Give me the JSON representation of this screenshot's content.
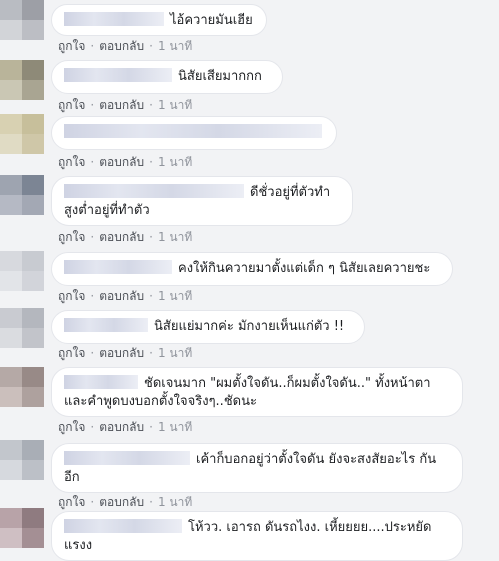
{
  "actions": {
    "like": "ถูกใจ",
    "reply": "ตอบกลับ",
    "separator": "·",
    "time": "1 นาที"
  },
  "comments": [
    {
      "text": "ไอ้ควายมันเฮีย",
      "avatar": [
        "#b9bcc2",
        "#9d9fa6",
        "#d2d4d8",
        "#bcbec4"
      ]
    },
    {
      "text": "นิสัยเสียมากกก",
      "avatar": [
        "#b9b49a",
        "#8e8a78",
        "#cac7b4",
        "#a9a592"
      ]
    },
    {
      "text": "",
      "avatar": [
        "#d8d1b2",
        "#c7bf9b",
        "#e0dbc4",
        "#cfc7a8"
      ]
    },
    {
      "text": "ดีชั่วอยู่ที่ตัวทำ สูงต่ำอยู่ที่ทำตัว",
      "avatar": [
        "#9ea4b0",
        "#7c8594",
        "#b5b9c4",
        "#a3a8b4"
      ]
    },
    {
      "text": "คงให้กินควายมาตั้งแต่เด็ก ๆ นิสัยเลยควายชะ",
      "avatar": [
        "#d7d9de",
        "#c8cbd1",
        "#e2e4e8",
        "#d2d4da"
      ]
    },
    {
      "text": "นิสัยแย่มากค่ะ มักงายเห็นแก่ตัว !!",
      "avatar": [
        "#c9cbd1",
        "#b4b7be",
        "#dadce0",
        "#c2c4ca"
      ]
    },
    {
      "text": "ชัดเจนมาก \"ผมตั้งใจดัน..ก็ผมตั้งใจดัน..\" ทั้งหน้าตา และคำพูดบงบอกตั้งใจจริงๆ..ชัดนะ",
      "avatar": [
        "#b5a9a6",
        "#988a87",
        "#cbbfbc",
        "#aea19e"
      ]
    },
    {
      "text": "เค้าก็บอกอยู่ว่าตั้งใจดัน ยังจะสงสัยอะไร กันอีก",
      "avatar": [
        "#c2c6cc",
        "#a9aeb6",
        "#d6d9de",
        "#bcc0c7"
      ]
    },
    {
      "text": "โห้วว. เอารถ ดันรถไงง. เหี้ยยยย....ประหยัด แรงง",
      "avatar": [
        "#b8a3a8",
        "#8f7b80",
        "#cfbfc3",
        "#a48f94"
      ]
    }
  ]
}
